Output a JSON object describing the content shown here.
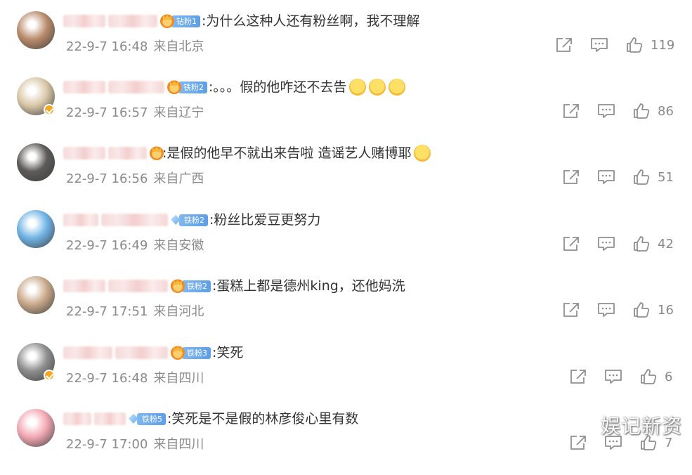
{
  "comments": [
    {
      "badge_type": "crown",
      "fan_label": "钻粉1",
      "text": "为什么这种人还有粉丝啊，我不理解",
      "emojis": [],
      "date": "22-9-7 16:48",
      "location": "来自北京",
      "likes": "119",
      "avatar_color": "#b98b6b"
    },
    {
      "badge_type": "crown",
      "fan_label": "铁粉2",
      "text": "。。。假的他咋还不去告",
      "emojis": [
        "laugh-cry-emoji",
        "laugh-cry-emoji",
        "laugh-cry-emoji"
      ],
      "date": "22-9-7 16:57",
      "location": "来自辽宁",
      "likes": "86",
      "avatar_color": "#d9c7a8"
    },
    {
      "badge_type": "crown",
      "fan_label": "",
      "text": "是假的他早不就出来告啦 造谣艺人赌博耶",
      "emojis": [
        "love-emoji"
      ],
      "date": "22-9-7 16:56",
      "location": "来自广西",
      "likes": "51",
      "avatar_color": "#5d5a58"
    },
    {
      "badge_type": "diamond",
      "fan_label": "铁粉2",
      "text": "粉丝比爱豆更努力",
      "emojis": [],
      "date": "22-9-7 16:49",
      "location": "来自安徽",
      "likes": "42",
      "avatar_color": "#6fb3e6"
    },
    {
      "badge_type": "crown",
      "fan_label": "铁粉2",
      "text": "蛋糕上都是德州king，还他妈洗",
      "emojis": [],
      "date": "22-9-7 17:51",
      "location": "来自河北",
      "likes": "16",
      "avatar_color": "#c9a98a"
    },
    {
      "badge_type": "crown",
      "fan_label": "铁粉3",
      "text": "笑死",
      "emojis": [],
      "date": "22-9-7 16:48",
      "location": "来自四川",
      "likes": "6",
      "avatar_color": "#8e8e8e"
    },
    {
      "badge_type": "diamond",
      "fan_label": "铁粉5",
      "text": "笑死是不是假的林彦俊心里有数",
      "emojis": [],
      "date": "22-9-7 17:00",
      "location": "来自四川",
      "likes": "7",
      "avatar_color": "#f2a8b3"
    }
  ],
  "watermark": "娱记新资"
}
